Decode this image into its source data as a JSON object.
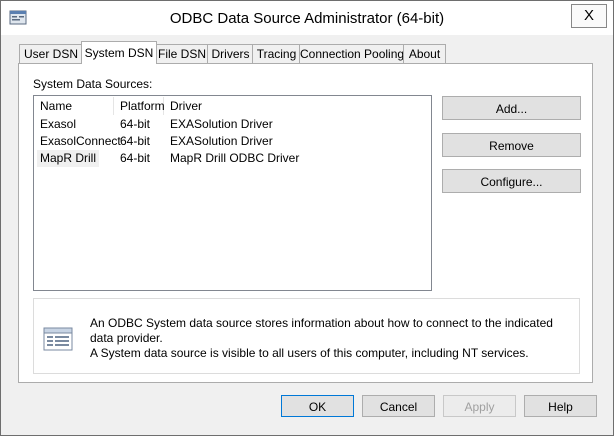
{
  "window": {
    "title": "ODBC Data Source Administrator (64-bit)",
    "close_label": "X"
  },
  "tabs": [
    {
      "label": "User DSN"
    },
    {
      "label": "System DSN",
      "active": true
    },
    {
      "label": "File DSN"
    },
    {
      "label": "Drivers"
    },
    {
      "label": "Tracing"
    },
    {
      "label": "Connection Pooling"
    },
    {
      "label": "About"
    }
  ],
  "panel": {
    "section_label": "System Data Sources:",
    "columns": [
      "Name",
      "Platform",
      "Driver"
    ],
    "rows": [
      {
        "name": "Exasol",
        "platform": "64-bit",
        "driver": "EXASolution Driver"
      },
      {
        "name": "ExasolConnect",
        "platform": "64-bit",
        "driver": "EXASolution Driver"
      },
      {
        "name": "MapR Drill",
        "platform": "64-bit",
        "driver": "MapR Drill ODBC Driver",
        "selected": true
      }
    ],
    "buttons": {
      "add": "Add...",
      "remove": "Remove",
      "configure": "Configure..."
    },
    "info_line1": "An ODBC System data source stores information about how to connect to the indicated data provider.",
    "info_line2": "A System data source is visible to all users of this computer, including NT services."
  },
  "footer": {
    "ok": "OK",
    "cancel": "Cancel",
    "apply": "Apply",
    "help": "Help"
  },
  "colors": {
    "accent": "#0078d7",
    "button_face": "#e1e1e1",
    "window_bg": "#f0f0f0"
  }
}
